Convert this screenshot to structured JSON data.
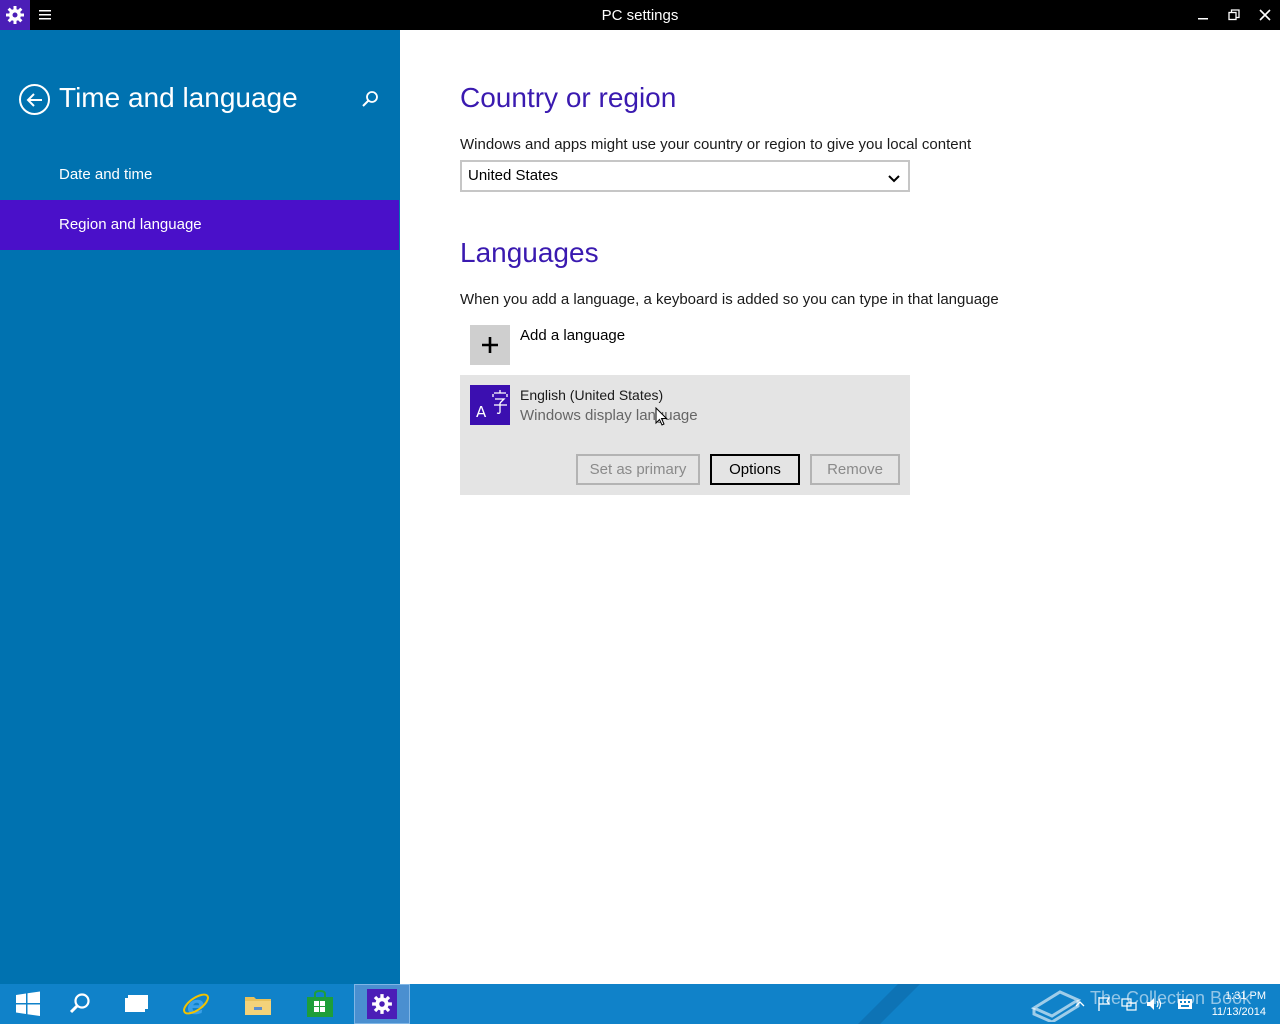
{
  "window": {
    "title": "PC settings",
    "app_icon": "gear-icon",
    "menu_icon": "hamburger-icon",
    "controls": [
      "minimize-icon",
      "restore-icon",
      "close-icon"
    ]
  },
  "sidebar": {
    "title": "Time and language",
    "back_icon": "back-arrow-icon",
    "search_icon": "search-icon",
    "items": [
      {
        "label": "Date and time",
        "selected": false
      },
      {
        "label": "Region and language",
        "selected": true
      }
    ]
  },
  "main": {
    "country": {
      "heading": "Country or region",
      "description": "Windows and apps might use your country or region to give you local content",
      "selected_value": "United States"
    },
    "languages": {
      "heading": "Languages",
      "description": "When you add a language, a keyboard is added so you can type in that language",
      "add_label": "Add a language",
      "items": [
        {
          "name": "English (United States)",
          "subtitle": "Windows display language",
          "icon": "language-icon",
          "buttons": {
            "set_primary": "Set as primary",
            "options": "Options",
            "remove": "Remove"
          }
        }
      ]
    }
  },
  "taskbar": {
    "items": [
      "start-icon",
      "search-icon",
      "task-view-icon",
      "internet-explorer-icon",
      "file-explorer-icon",
      "store-icon",
      "settings-icon"
    ],
    "watermark": "The Collection Book",
    "clock": {
      "time": "1:31 PM",
      "date": "11/13/2014"
    }
  },
  "colors": {
    "sidebar": "#0072b0",
    "selection": "#4a10c9",
    "accent_heading": "#3a1ab0",
    "taskbar": "#1082c9"
  }
}
